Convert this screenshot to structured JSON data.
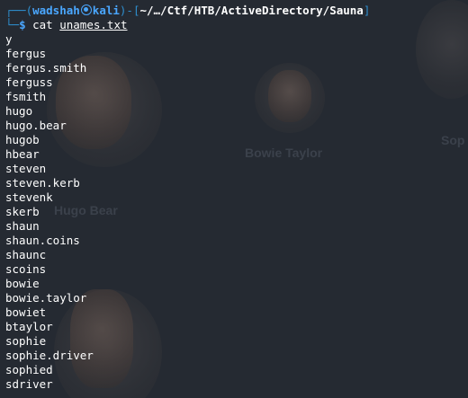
{
  "background": {
    "names": {
      "hugo": "Hugo Bear",
      "bowie": "Bowie Taylor",
      "sophie": "Sop"
    }
  },
  "terminal": {
    "prompt": {
      "frame_left": "┌──(",
      "user": "wadshah",
      "host": "kali",
      "frame_mid": ")-[",
      "path": "~/…/Ctf/HTB/ActiveDirectory/Sauna",
      "frame_right": "]",
      "frame_lower": "└─",
      "dollar": "$",
      "command": "cat",
      "argument": "unames.txt"
    },
    "output": [
      "y",
      "fergus",
      "fergus.smith",
      "ferguss",
      "fsmith",
      "hugo",
      "hugo.bear",
      "hugob",
      "hbear",
      "steven",
      "steven.kerb",
      "stevenk",
      "skerb",
      "shaun",
      "shaun.coins",
      "shaunc",
      "scoins",
      "bowie",
      "bowie.taylor",
      "bowiet",
      "btaylor",
      "sophie",
      "sophie.driver",
      "sophied",
      "sdriver"
    ]
  },
  "colors": {
    "background": "#252a32",
    "prompt_accent": "#4aa7ff",
    "prompt_frame": "#2e8fcf",
    "text": "#ffffff"
  }
}
